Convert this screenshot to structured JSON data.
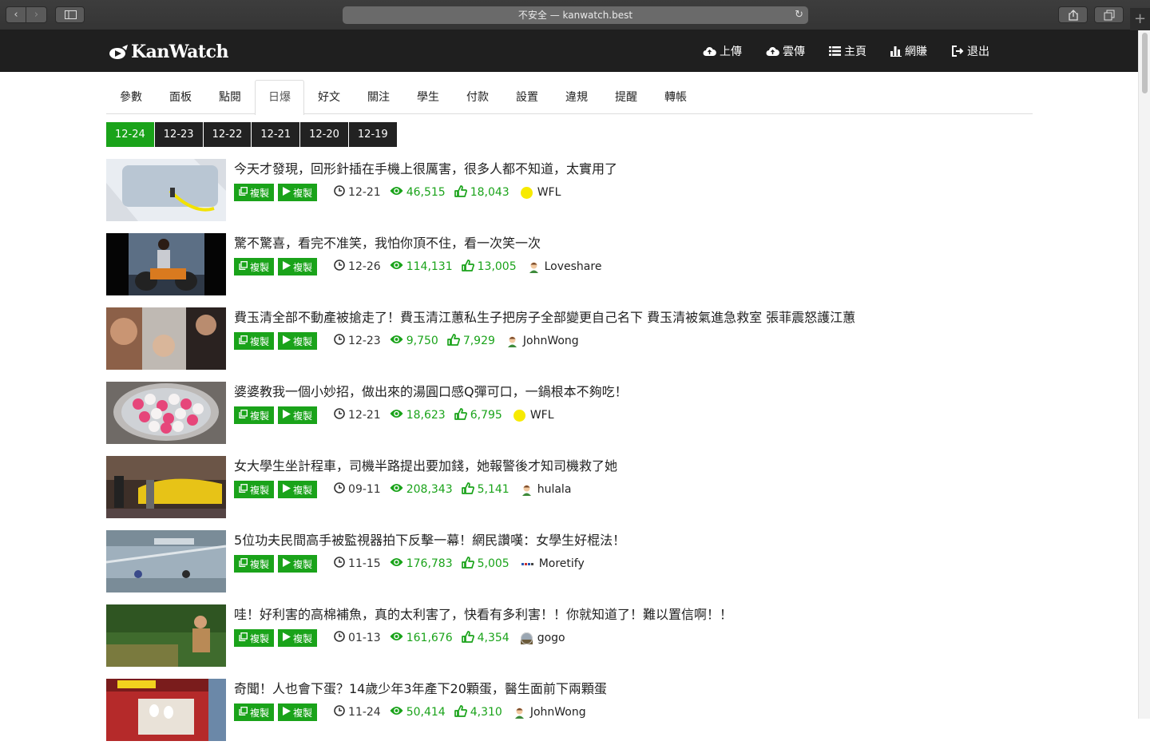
{
  "browser": {
    "address": "不安全 — kanwatch.best"
  },
  "header": {
    "logo": "KanWatch",
    "nav": [
      {
        "label": "上傳",
        "icon": "cloud-upload-icon"
      },
      {
        "label": "雲傳",
        "icon": "cloud-upload-icon"
      },
      {
        "label": "主頁",
        "icon": "list-icon"
      },
      {
        "label": "網賺",
        "icon": "bar-chart-icon"
      },
      {
        "label": "退出",
        "icon": "logout-icon"
      }
    ]
  },
  "tabs": [
    "參數",
    "面板",
    "點閱",
    "日爆",
    "好文",
    "關注",
    "學生",
    "付款",
    "設置",
    "違規",
    "提醒",
    "轉帳"
  ],
  "active_tab": "日爆",
  "dates": [
    "12-24",
    "12-23",
    "12-22",
    "12-21",
    "12-20",
    "12-19"
  ],
  "active_date": "12-24",
  "copy_label": "複製",
  "colors": {
    "accent": "#1aa31a",
    "header": "#1f1f1f"
  },
  "articles": [
    {
      "title": "今天才發現，回形針插在手機上很厲害，很多人都不知道，太實用了",
      "date": "12-21",
      "views": "46,515",
      "likes": "18,043",
      "author": "WFL",
      "avatar": "yellow"
    },
    {
      "title": "驚不驚喜，看完不准笑，我怕你頂不住，看一次笑一次",
      "date": "12-26",
      "views": "114,131",
      "likes": "13,005",
      "author": "Loveshare",
      "avatar": "cartoon"
    },
    {
      "title": "費玉清全部不動產被搶走了！費玉清江蕙私生子把房子全部變更自己名下 費玉清被氣進急救室 張菲震怒護江蕙",
      "date": "12-23",
      "views": "9,750",
      "likes": "7,929",
      "author": "JohnWong",
      "avatar": "cartoon"
    },
    {
      "title": "婆婆教我一個小妙招，做出來的湯圓口感Q彈可口，一鍋根本不夠吃！",
      "date": "12-21",
      "views": "18,623",
      "likes": "6,795",
      "author": "WFL",
      "avatar": "yellow"
    },
    {
      "title": "女大學生坐計程車，司機半路提出要加錢，她報警後才知司機救了她",
      "date": "09-11",
      "views": "208,343",
      "likes": "5,141",
      "author": "hulala",
      "avatar": "cartoon"
    },
    {
      "title": "5位功夫民間高手被監視器拍下反擊一幕！網民讚嘆：女學生好棍法！",
      "date": "11-15",
      "views": "176,783",
      "likes": "5,005",
      "author": "Moretify",
      "avatar": "logo"
    },
    {
      "title": "哇！好利害的高棉補魚，真的太利害了，快看有多利害！！你就知道了！難以置信啊！！",
      "date": "01-13",
      "views": "161,676",
      "likes": "4,354",
      "author": "gogo",
      "avatar": "landscape"
    },
    {
      "title": "奇聞！人也會下蛋？14歲少年3年產下20顆蛋，醫生面前下兩顆蛋",
      "date": "11-24",
      "views": "50,414",
      "likes": "4,310",
      "author": "JohnWong",
      "avatar": "cartoon"
    }
  ]
}
